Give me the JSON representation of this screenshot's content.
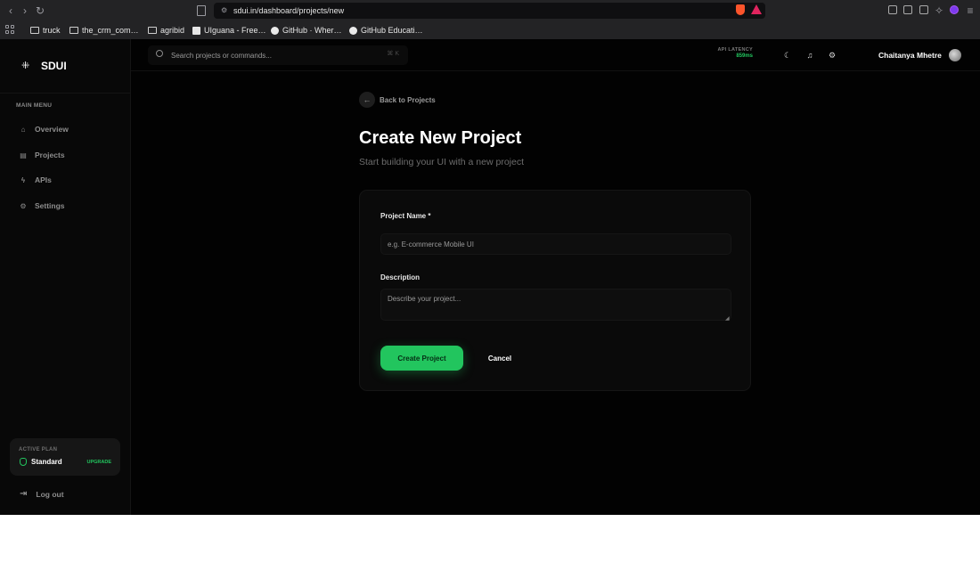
{
  "browser": {
    "url": "sdui.in/dashboard/projects/new",
    "bookmarks": [
      "truck",
      "the_crm_com…",
      "agribid",
      "UIguana - Free…",
      "GitHub · Wher…",
      "GitHub Educati…"
    ]
  },
  "app": {
    "brand": "SDUI",
    "search_placeholder": "Search projects or commands...",
    "search_shortcut": "⌘ K",
    "latency_label": "API LATENCY",
    "latency_value": "859ms",
    "user_name": "Chaitanya Mhetre"
  },
  "sidebar": {
    "section_label": "MAIN MENU",
    "items": [
      {
        "label": "Overview",
        "icon": "home-icon"
      },
      {
        "label": "Projects",
        "icon": "layout-icon"
      },
      {
        "label": "APIs",
        "icon": "zap-icon"
      },
      {
        "label": "Settings",
        "icon": "gear-icon"
      }
    ],
    "plan_label": "ACTIVE PLAN",
    "plan_name": "Standard",
    "upgrade_label": "UPGRADE",
    "logout_label": "Log out"
  },
  "main": {
    "back_label": "Back to Projects",
    "title": "Create New Project",
    "subtitle": "Start building your UI with a new project",
    "form": {
      "name_label": "Project Name *",
      "name_placeholder": "e.g. E-commerce Mobile UI",
      "name_value": "",
      "description_label": "Description",
      "description_placeholder": "Describe your project...",
      "description_value": "",
      "submit_label": "Create Project",
      "cancel_label": "Cancel"
    }
  },
  "colors": {
    "accent": "#22c55e",
    "background": "#020202",
    "card": "#0a0a0a"
  }
}
